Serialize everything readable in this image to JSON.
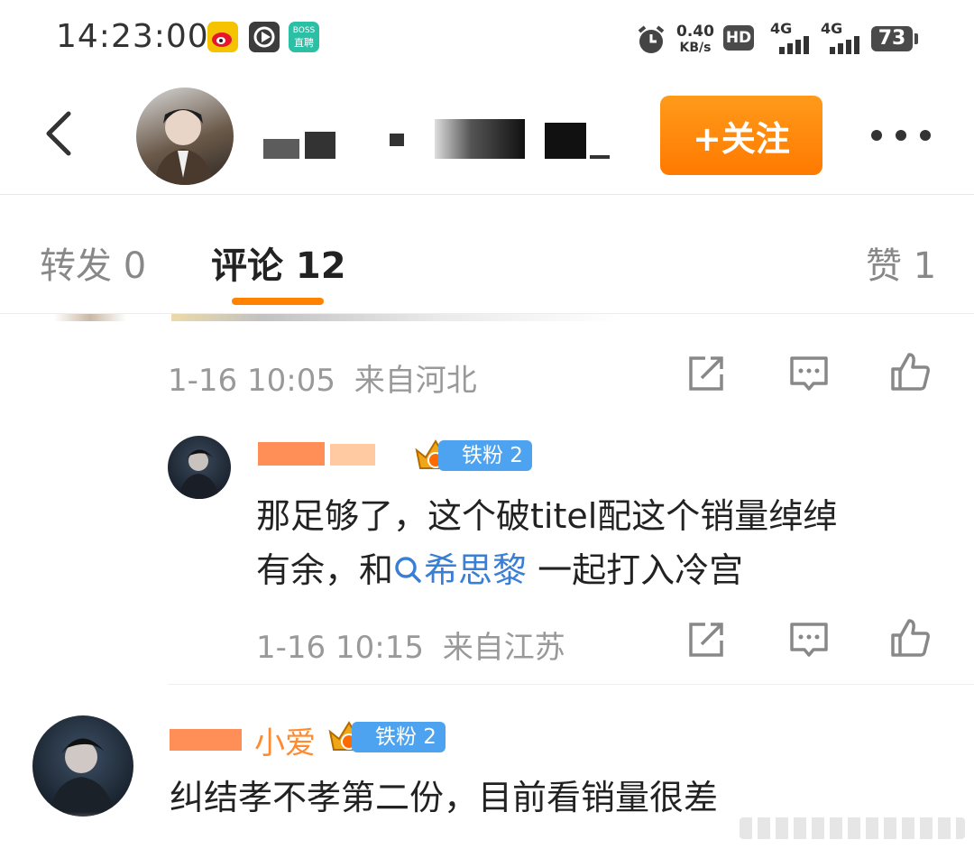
{
  "status_bar": {
    "time": "14:23:00",
    "net_speed_value": "0.40",
    "net_speed_unit": "KB/s",
    "hd_label": "HD",
    "signal_1": "4G",
    "signal_2": "4G",
    "battery": "73",
    "app_icons": [
      "weibo-icon",
      "video-icon",
      "boss-zhipin-icon"
    ],
    "boss_label_top": "BOSS",
    "boss_label_bottom": "直聘"
  },
  "header": {
    "follow_label": "+关注",
    "more_label": "•••"
  },
  "tabs": [
    {
      "label": "转发 0",
      "active": false
    },
    {
      "label": "评论 12",
      "active": true
    },
    {
      "label": "赞 1",
      "active": false
    }
  ],
  "comments": [
    {
      "time": "1-16 10:05",
      "location": "来自河北"
    },
    {
      "badge": "铁粉 2",
      "badge_level": "1",
      "text_line1": "那足够了，这个破titel配这个销量绰绰",
      "text_line2_prefix": "有余，和",
      "link": "希思黎",
      "text_line2_suffix": " 一起打入冷宫",
      "time": "1-16 10:15",
      "location": "来自江苏"
    },
    {
      "badge": "铁粉 2",
      "badge_level": "1",
      "name_fragment": "小爱",
      "text": "纠结孝不孝第二份，目前看销量很差"
    }
  ],
  "colors": {
    "accent": "#ff8200",
    "link": "#3a7fd6",
    "badge": "#4da3f0"
  }
}
